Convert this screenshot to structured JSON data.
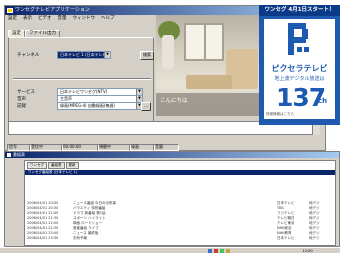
{
  "app": {
    "title": "ワンセグテレビアプリケーション",
    "menu": [
      "設定",
      "表示",
      "ビデオ",
      "音量",
      "ウィンドウ",
      "ヘルプ"
    ],
    "tabs": [
      "設定",
      "ファイル出力"
    ],
    "fields": {
      "channel_label": "チャンネル",
      "channel_value": "日本テレビ 1 (日本テレビ)",
      "channel_button": "検索",
      "service_label": "サービス",
      "service_value": "日本テレビワンセグ(NTV)",
      "audio_label": "音声",
      "audio_value": "主音声",
      "mode_label": "記録",
      "mode_value": "録画(MPEG-4) 自動録画(毎週)",
      "mode_button": "…"
    },
    "greeting": "こんにちは",
    "statusbar": [
      "信号",
      "受信中",
      "00:00:00",
      "視聴中",
      "録画",
      "音量"
    ]
  },
  "ad": {
    "headline": "ワンセグ 4月1日スタート！",
    "brand": "ピクセラテレビ",
    "sub": "地上波デジタル放送は",
    "channel_number": "137",
    "channel_unit": "ch",
    "footnote": "詳細情報はこちら",
    "accent_color": "#1e5bb0"
  },
  "lower": {
    "title": "番組表",
    "toolbar": [
      "ワンセグ",
      "番組表",
      "更新"
    ],
    "query": "ワンセグ番組表 (日本テレビ 1)",
    "rows": [
      [
        "2006/04/01 20:00",
        "ニュース番組 今日の出来事",
        "日本テレビ",
        "地デジ"
      ],
      [
        "2006/04/01 20:30",
        "バラエティ 特別番組",
        "TBS",
        "地デジ"
      ],
      [
        "2006/04/01 21:00",
        "ドラマ 新番組 第1話",
        "フジテレビ",
        "地デジ"
      ],
      [
        "2006/04/01 21:30",
        "スポーツ ハイライト",
        "テレビ朝日",
        "地デジ"
      ],
      [
        "2006/04/01 22:00",
        "映画 ロードショー",
        "テレビ東京",
        "地デジ"
      ],
      [
        "2006/04/01 22:30",
        "音楽番組 ライブ",
        "NHK総合",
        "地デジ"
      ],
      [
        "2006/04/01 23:00",
        "ニュース 最終版",
        "NHK教育",
        "地デジ"
      ],
      [
        "2006/04/01 23:30",
        "天気予報",
        "日本テレビ",
        "地デジ"
      ]
    ]
  },
  "taskbar": {
    "clock": "12:00"
  }
}
